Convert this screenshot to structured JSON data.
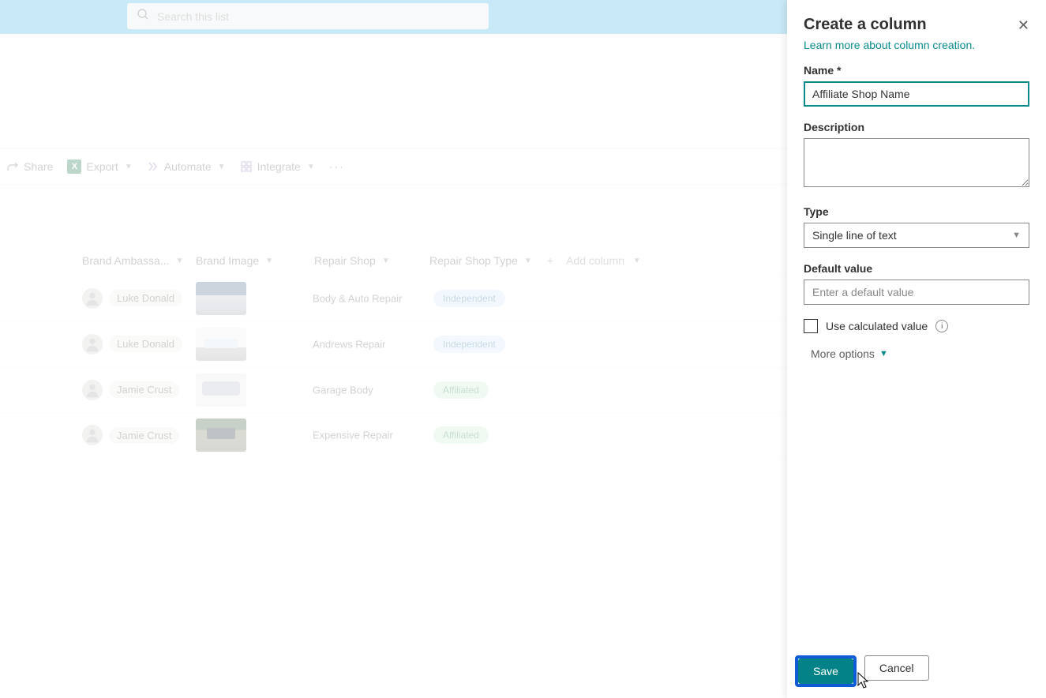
{
  "search": {
    "placeholder": "Search this list"
  },
  "toolbar": {
    "share": "Share",
    "export": "Export",
    "automate": "Automate",
    "integrate": "Integrate"
  },
  "columns": {
    "brand_ambassador": "Brand Ambassa...",
    "brand_image": "Brand Image",
    "repair_shop": "Repair Shop",
    "repair_shop_type": "Repair Shop Type",
    "add_column": "Add column"
  },
  "rows": [
    {
      "ambassador": "Luke Donald",
      "repair_shop": "Body & Auto Repair",
      "repair_shop_type": "Independent",
      "badge_class": "independent",
      "img_class": "bi1"
    },
    {
      "ambassador": "Luke Donald",
      "repair_shop": "Andrews Repair",
      "repair_shop_type": "Independent",
      "badge_class": "independent",
      "img_class": "bi2"
    },
    {
      "ambassador": "Jamie Crust",
      "repair_shop": "Garage Body",
      "repair_shop_type": "Affiliated",
      "badge_class": "affiliated",
      "img_class": "bi3"
    },
    {
      "ambassador": "Jamie Crust",
      "repair_shop": "Expensive Repair",
      "repair_shop_type": "Affiliated",
      "badge_class": "affiliated",
      "img_class": "bi4"
    }
  ],
  "panel": {
    "title": "Create a column",
    "learn_more": "Learn more about column creation.",
    "name_label": "Name *",
    "name_value": "Affiliate Shop Name",
    "description_label": "Description",
    "description_value": "",
    "type_label": "Type",
    "type_value": "Single line of text",
    "default_label": "Default value",
    "default_placeholder": "Enter a default value",
    "default_value": "",
    "calculated_label": "Use calculated value",
    "more_options": "More options",
    "save": "Save",
    "cancel": "Cancel"
  }
}
